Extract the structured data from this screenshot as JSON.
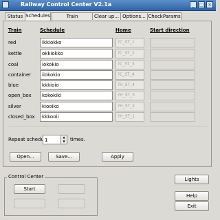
{
  "window": {
    "title": "Railway Control Center   V2.1a"
  },
  "tabs": [
    {
      "label": "Status"
    },
    {
      "label": "Schedules",
      "active": true
    },
    {
      "label": "Train parameters"
    },
    {
      "label": "Clear up..."
    },
    {
      "label": "Options..."
    },
    {
      "label": "CheckParams"
    }
  ],
  "columns": {
    "train": "Train",
    "schedule": "Schedule",
    "home": "Home",
    "start_direction": "Start direction"
  },
  "rows": [
    {
      "train": "red",
      "schedule": "ikkiokko",
      "home": "?C_ST_1"
    },
    {
      "train": "kettle",
      "schedule": "okkiokko",
      "home": "?C_ST_2"
    },
    {
      "train": "coal",
      "schedule": "iokokio",
      "home": "?C_ST_3"
    },
    {
      "train": "container",
      "schedule": "iiokokio",
      "home": "?C_ST_4"
    },
    {
      "train": "blue",
      "schedule": "kkkioio",
      "home": "?H_ST_4"
    },
    {
      "train": "open_box",
      "schedule": "kokokiki",
      "home": "?H_ST_3"
    },
    {
      "train": "silver",
      "schedule": "kiooiko",
      "home": "?H_ST_2"
    },
    {
      "train": "closed_box",
      "schedule": "kkkooii",
      "home": "?H_ST_1"
    }
  ],
  "repeat": {
    "label": "Repeat schedule",
    "value": "1",
    "suffix": "times."
  },
  "buttons": {
    "open": "Open...",
    "save": "Save...",
    "apply": "Apply",
    "start": "Start",
    "lights": "Lights",
    "help": "Help",
    "exit": "Exit"
  },
  "control_center": {
    "title": "Control Center"
  }
}
